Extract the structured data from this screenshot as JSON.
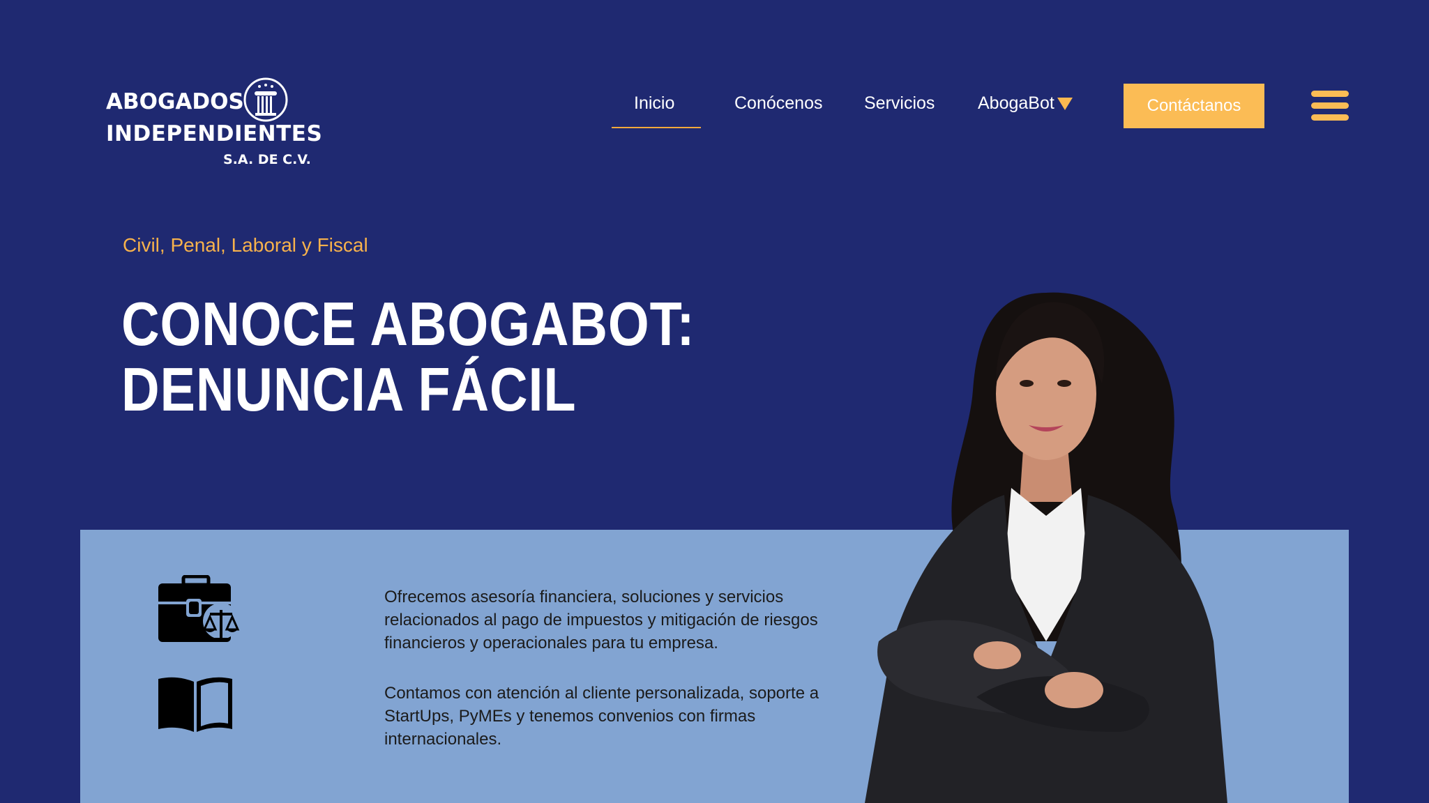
{
  "logo": {
    "line1": "ABOGADOS",
    "line2": "INDEPENDIENTES",
    "line3": "S.A. DE C.V."
  },
  "nav": {
    "items": [
      {
        "label": "Inicio",
        "active": true
      },
      {
        "label": "Conócenos"
      },
      {
        "label": "Servicios"
      },
      {
        "label": "AbogaBot"
      }
    ],
    "cta_label": "Contáctanos"
  },
  "hero": {
    "tagline": "Civil, Penal, Laboral y Fiscal",
    "headline_line1": "CONOCE ABOGABOT:",
    "headline_line2": "DENUNCIA FÁCIL"
  },
  "features": [
    {
      "icon": "briefcase-scales-icon",
      "text": "Ofrecemos asesoría financiera, soluciones y servicios relacionados al pago de impuestos y mitigación de riesgos financieros y operacionales para tu empresa."
    },
    {
      "icon": "open-book-icon",
      "text": "Contamos con atención al cliente personalizada, soporte a StartUps, PyMEs y tenemos convenios con firmas internacionales."
    }
  ],
  "colors": {
    "background": "#1f2971",
    "accent": "#fbbc55",
    "panel": "#82a4d2"
  }
}
